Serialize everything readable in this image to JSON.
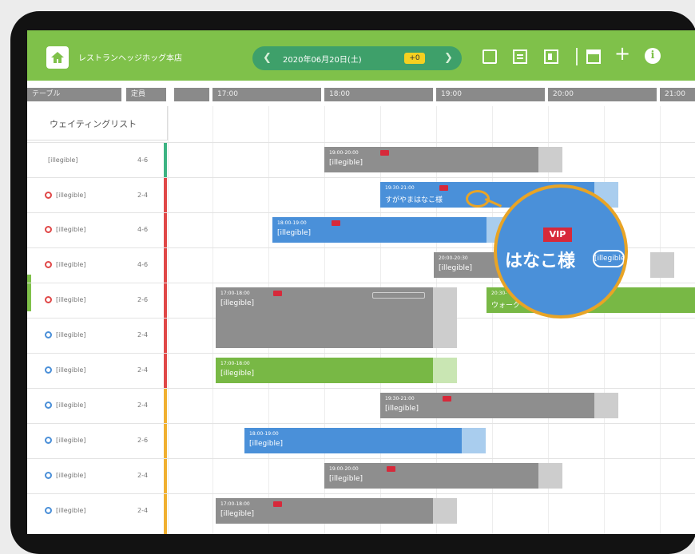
{
  "topbar": {
    "store_name": "レストランヘッジホッグ本店",
    "date_text": "2020年06月20日(土)",
    "date_badge": "+0"
  },
  "table_header": {
    "table_col": "テーブル",
    "capacity_col": "定員",
    "times": [
      "17:00",
      "18:00",
      "19:00",
      "20:00",
      "21:00"
    ]
  },
  "waiting_list_label": "ウェイティングリスト",
  "rows": [
    {
      "name": "[illegible]",
      "capacity": "4-6"
    },
    {
      "name": "[illegible]",
      "capacity": "2-4"
    },
    {
      "name": "[illegible]",
      "capacity": "4-6"
    },
    {
      "name": "[illegible]",
      "capacity": "4-6"
    },
    {
      "name": "[illegible]",
      "capacity": "2-6"
    },
    {
      "name": "[illegible]",
      "capacity": "2-4"
    },
    {
      "name": "[illegible]",
      "capacity": "2-4"
    },
    {
      "name": "[illegible]",
      "capacity": "2-4"
    },
    {
      "name": "[illegible]",
      "capacity": "2-6"
    },
    {
      "name": "[illegible]",
      "capacity": "2-4"
    },
    {
      "name": "[illegible]",
      "capacity": "2-4"
    }
  ],
  "reservations": [
    {
      "time": "19:00-20:00",
      "name": "[illegible]"
    },
    {
      "time": "19:30-21:00",
      "name": "すがやまはなこ様"
    },
    {
      "time": "18:00-19:00",
      "name": "[illegible]"
    },
    {
      "time": "20:00-20:30",
      "name": "[illegible]"
    },
    {
      "time": "17:00-18:00",
      "name": "[illegible]"
    },
    {
      "time": "20:30-",
      "name": "ウォーク"
    },
    {
      "time": "17:00-18:00",
      "name": "[illegible]"
    },
    {
      "time": "19:30-21:00",
      "name": "[illegible]"
    },
    {
      "time": "18:00-19:00",
      "name": "[illegible]"
    },
    {
      "time": "19:00-20:00",
      "name": "[illegible]"
    },
    {
      "time": "17:00-18:00",
      "name": "[illegible]"
    }
  ],
  "zoom": {
    "vip_label": "VIP",
    "name": "はなこ様",
    "count": "[illegible]"
  },
  "colors": {
    "brand_green": "#7fc14a",
    "reservation_blue": "#4a90d9",
    "reservation_gray": "#8e8e8e",
    "vip_red": "#d7293a",
    "highlight_orange": "#e8a426"
  }
}
